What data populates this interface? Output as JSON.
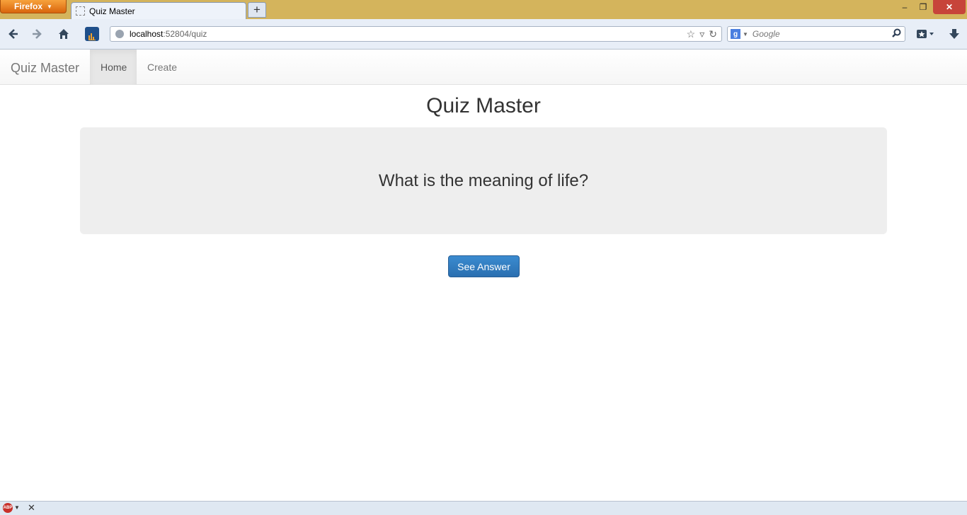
{
  "browser": {
    "menu_label": "Firefox",
    "tab_title": "Quiz Master",
    "new_tab_glyph": "+",
    "window_controls": {
      "minimize": "–",
      "maximize": "❐",
      "close": "✕"
    },
    "url_host": "localhost",
    "url_path": ":52804/quiz",
    "search_placeholder": "Google",
    "icons": [
      "back-icon",
      "forward-icon",
      "home-icon",
      "stats-addon-icon",
      "bookmark-star-icon",
      "reload-icon",
      "search-icon",
      "bookmarks-menu-icon",
      "download-icon"
    ]
  },
  "site": {
    "brand": "Quiz Master",
    "nav": [
      {
        "label": "Home",
        "active": true
      },
      {
        "label": "Create",
        "active": false
      }
    ],
    "page_title": "Quiz Master",
    "question": "What is the meaning of life?",
    "answer_button": "See Answer"
  },
  "addon_bar": {
    "abp_label": "ABP",
    "close_glyph": "✕"
  },
  "colors": {
    "titlebar": "#d4b45c",
    "firefox_button": "#e8820f",
    "jumbotron_bg": "#eeeeee",
    "primary_button": "#337ab7"
  }
}
